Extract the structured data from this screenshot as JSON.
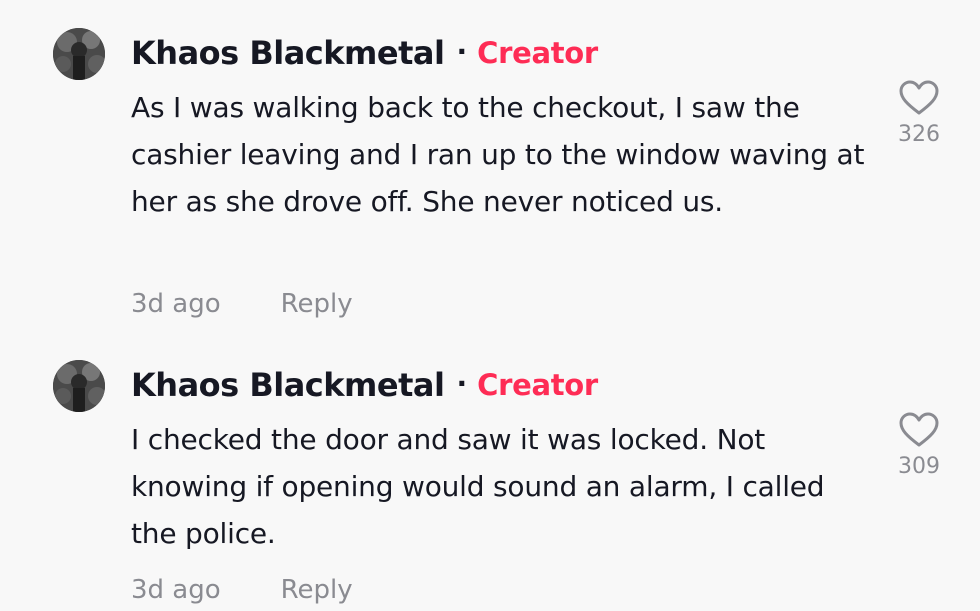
{
  "comments": [
    {
      "username": "Khaos Blackmetal",
      "separator": "·",
      "badge": "Creator",
      "text": "As I was walking back to the checkout, I saw the cashier leaving and I ran up to the window waving at her as she drove off. She never noticed us.",
      "time": "3d ago",
      "reply_label": "Reply",
      "likes": "326",
      "like_icon": "heart-outline-icon"
    },
    {
      "username": "Khaos Blackmetal",
      "separator": "·",
      "badge": "Creator",
      "text": "I checked the door and saw it was locked. Not knowing if opening would sound an alarm, I called the police.",
      "time": "3d ago",
      "reply_label": "Reply",
      "likes": "309",
      "like_icon": "heart-outline-icon"
    }
  ],
  "colors": {
    "background": "#f8f8f8",
    "text": "#161823",
    "creator_badge": "#fe2c55",
    "muted": "#8a8b91"
  }
}
